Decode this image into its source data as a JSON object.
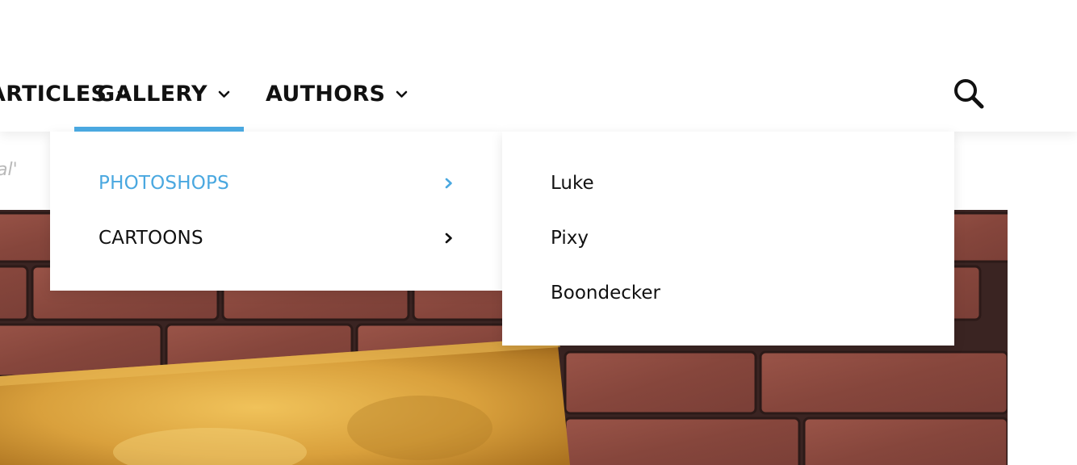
{
  "nav": {
    "items": [
      {
        "label": "ARTICLES",
        "id": "articles"
      },
      {
        "label": "GALLERY",
        "id": "gallery"
      },
      {
        "label": "AUTHORS",
        "id": "authors"
      }
    ],
    "active": "GALLERY",
    "search_icon": "search-icon",
    "chevron_icon": "chevron-down-icon"
  },
  "subtext": "al'",
  "dropdown": {
    "items": [
      {
        "label": "PHOTOSHOPS",
        "active": true
      },
      {
        "label": "CARTOONS",
        "active": false
      }
    ],
    "arrow_icon": "chevron-right-icon"
  },
  "submenu": {
    "items": [
      {
        "label": "Luke"
      },
      {
        "label": "Pixy"
      },
      {
        "label": "Boondecker"
      }
    ]
  },
  "colors": {
    "accent": "#4aa8e0",
    "text": "#111111",
    "muted": "#b9b9b9",
    "brick": "#8e4a3f",
    "mortar": "#3a2422",
    "gold": "#d9a03c"
  }
}
